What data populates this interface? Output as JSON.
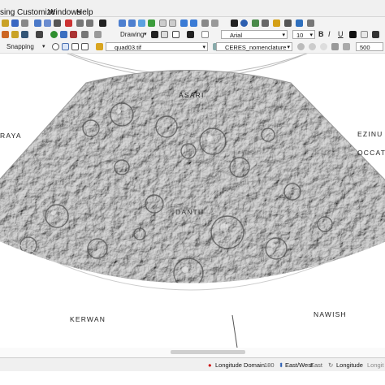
{
  "menu": [
    "sing",
    "Customize",
    "Windows",
    "Help"
  ],
  "toolbar": {
    "drawing_label": "Drawing",
    "font_name": "Arial",
    "font_size": "10",
    "bold": "B",
    "italic": "I",
    "underline": "U",
    "snapping_label": "Snapping",
    "layer_select": "quad03.tif",
    "nomenclature_select": "CERES_nomenclature",
    "scale_value": "500"
  },
  "map": {
    "regions": {
      "asari": "ASARI",
      "raya": "RAYA",
      "ezinu": "EZINU",
      "occat": "OCCAT",
      "dantu": "DANTU",
      "kerwan": "KERWAN",
      "nawish": "NAWISH"
    }
  },
  "statusbar": {
    "longitude_domain_label": "Longitude Domain",
    "longitude_domain_value": "180",
    "east_west_label": "East/West",
    "east_west_value": "East",
    "longitude_label": "Longitude",
    "longitude_trunc": "Longit"
  },
  "colors": {
    "toolbar_bg": "#f3f3f3",
    "map_gray": "#a9a9a9"
  },
  "icons": [
    "folder-icon",
    "save-icon",
    "zoom-in-icon",
    "zoom-out-icon",
    "pan-icon",
    "select-arrow-icon",
    "info-icon",
    "globe-icon",
    "text-tool-icon",
    "bold-icon",
    "italic-icon",
    "underline-icon"
  ]
}
